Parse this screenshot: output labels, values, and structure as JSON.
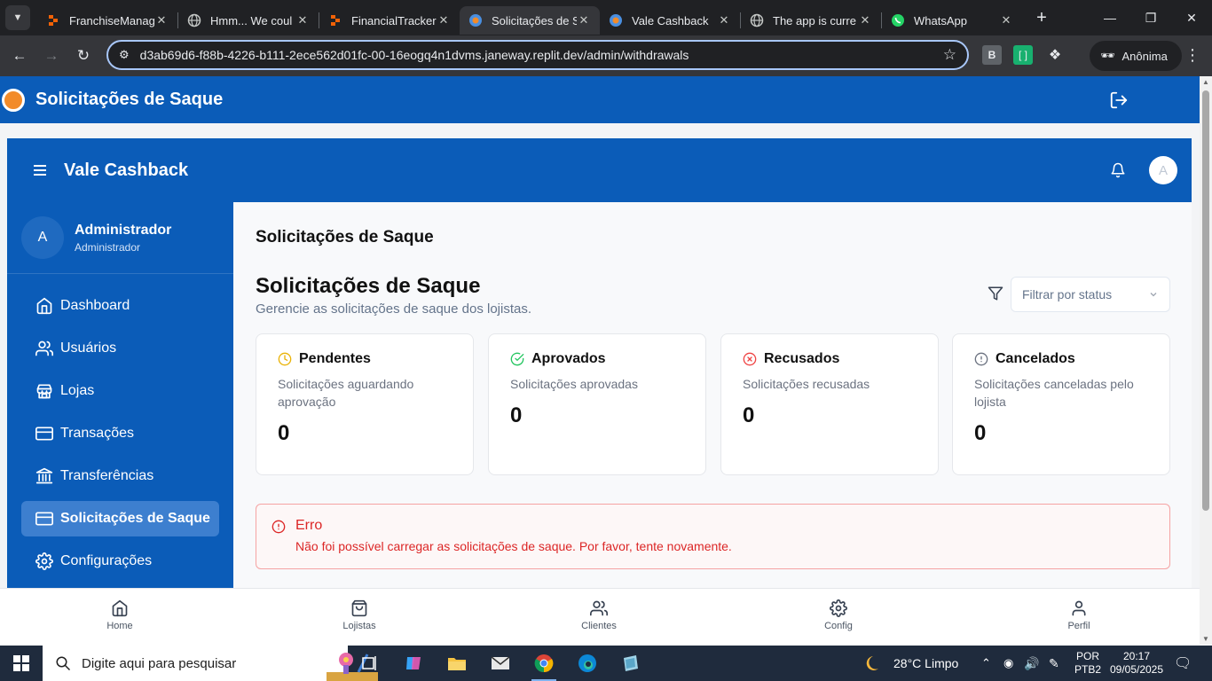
{
  "browser": {
    "tabs": [
      {
        "title": "FranchiseManag",
        "icon": "replit-icon",
        "active": false
      },
      {
        "title": "Hmm... We coul",
        "icon": "globe-icon",
        "active": false
      },
      {
        "title": "FinancialTracker",
        "icon": "replit-icon",
        "active": false
      },
      {
        "title": "Solicitações de S",
        "icon": "app-icon",
        "active": true
      },
      {
        "title": "Vale Cashback",
        "icon": "app-icon",
        "active": false
      },
      {
        "title": "The app is curre",
        "icon": "globe-icon",
        "active": false
      },
      {
        "title": "WhatsApp",
        "icon": "whatsapp-icon",
        "active": false
      }
    ],
    "url": "d3ab69d6-f88b-4226-b111-2ece562d01fc-00-16eogq4n1dvms.janeway.replit.dev/admin/withdrawals",
    "profile_label": "Anônima",
    "ext_b_label": "B"
  },
  "outer": {
    "title": "Solicitações de Saque"
  },
  "app": {
    "brand": "Vale Cashback",
    "avatar_letter": "A",
    "user": {
      "initial": "A",
      "name": "Administrador",
      "role": "Administrador"
    },
    "nav": [
      {
        "label": "Dashboard",
        "icon": "home-icon",
        "active": false
      },
      {
        "label": "Usuários",
        "icon": "users-icon",
        "active": false
      },
      {
        "label": "Lojas",
        "icon": "store-icon",
        "active": false
      },
      {
        "label": "Transações",
        "icon": "credit-card-icon",
        "active": false
      },
      {
        "label": "Transferências",
        "icon": "bank-icon",
        "active": false
      },
      {
        "label": "Solicitações de Saque",
        "icon": "credit-card-icon",
        "active": true
      },
      {
        "label": "Configurações",
        "icon": "gear-icon",
        "active": false
      }
    ]
  },
  "main": {
    "page_heading": "Solicitações de Saque",
    "section_title": "Solicitações de Saque",
    "section_subtitle": "Gerencie as solicitações de saque dos lojistas.",
    "filter_placeholder": "Filtrar por status",
    "cards": [
      {
        "title": "Pendentes",
        "desc": "Solicitações aguardando aprovação",
        "value": "0",
        "icon": "clock-icon",
        "color": "#eab308"
      },
      {
        "title": "Aprovados",
        "desc": "Solicitações aprovadas",
        "value": "0",
        "icon": "check-circle-icon",
        "color": "#22c55e"
      },
      {
        "title": "Recusados",
        "desc": "Solicitações recusadas",
        "value": "0",
        "icon": "x-circle-icon",
        "color": "#ef4444"
      },
      {
        "title": "Cancelados",
        "desc": "Solicitações canceladas pelo lojista",
        "value": "0",
        "icon": "alert-circle-icon",
        "color": "#6b7280"
      }
    ],
    "error": {
      "title": "Erro",
      "message": "Não foi possível carregar as solicitações de saque. Por favor, tente novamente."
    }
  },
  "bottom_nav": [
    {
      "label": "Home",
      "icon": "home-icon"
    },
    {
      "label": "Lojistas",
      "icon": "shopping-bag-icon"
    },
    {
      "label": "Clientes",
      "icon": "users-icon"
    },
    {
      "label": "Config",
      "icon": "gear-icon"
    },
    {
      "label": "Perfil",
      "icon": "user-icon"
    }
  ],
  "taskbar": {
    "search_placeholder": "Digite aqui para pesquisar",
    "weather": "28°C  Limpo",
    "lang_top": "POR",
    "lang_bottom": "PTB2",
    "time": "20:17",
    "date": "09/05/2025"
  },
  "colors": {
    "primary": "#0b5cb8",
    "active_nav": "#3d7fcf",
    "error": "#dc2626"
  }
}
